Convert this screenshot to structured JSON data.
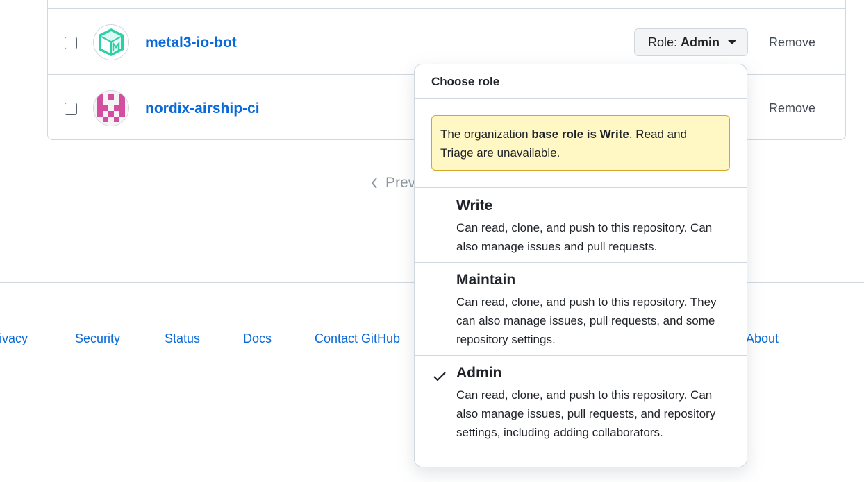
{
  "members": [
    {
      "name": "metal3-io-bot",
      "role_prefix": "Role:",
      "role_value": "Admin",
      "remove_label": "Remove",
      "avatar_color": "#2ccfa6"
    },
    {
      "name": "nordix-airship-ci",
      "remove_label": "Remove",
      "avatar_color": "#d44ea0"
    }
  ],
  "pagination": {
    "prev_label": "Prev"
  },
  "footer": {
    "links": [
      "rivacy",
      "Security",
      "Status",
      "Docs",
      "Contact GitHub",
      "About"
    ]
  },
  "role_menu": {
    "title": "Choose role",
    "notice": {
      "prefix": "The organization ",
      "bold": "base role is Write",
      "suffix": ". Read and Triage are unavailable."
    },
    "options": [
      {
        "label": "Write",
        "description": "Can read, clone, and push to this repository. Can also manage issues and pull requests.",
        "selected": false
      },
      {
        "label": "Maintain",
        "description": "Can read, clone, and push to this repository. They can also manage issues, pull requests, and some repository settings.",
        "selected": false
      },
      {
        "label": "Admin",
        "description": "Can read, clone, and push to this repository. Can also manage issues, pull requests, and repository settings, including adding collaborators.",
        "selected": true
      }
    ]
  },
  "colors": {
    "link": "#0969da",
    "border": "#d0d7de",
    "notice_bg": "#fff8c5",
    "notice_border": "#d4a72c"
  }
}
